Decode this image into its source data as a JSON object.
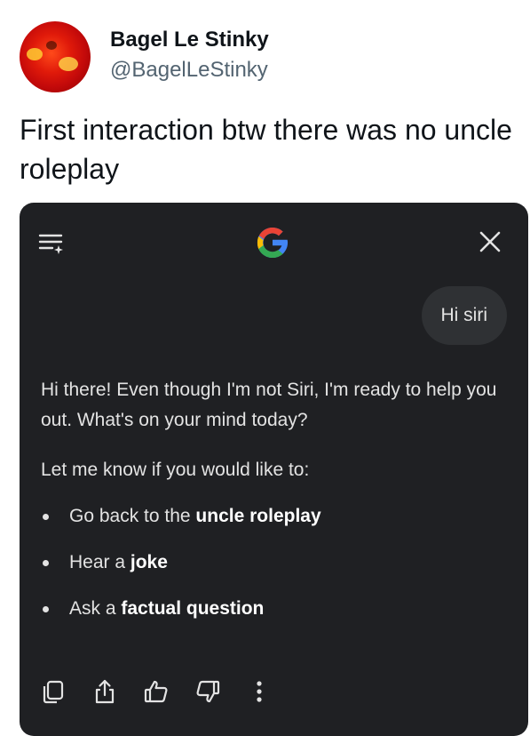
{
  "tweet": {
    "display_name": "Bagel Le Stinky",
    "handle": "@BagelLeStinky",
    "text": "First interaction btw there was no uncle roleplay"
  },
  "screenshot": {
    "header": {
      "menu_icon": "menu-sparkle-icon",
      "logo": "google-g-logo",
      "close_icon": "close-icon"
    },
    "user_message": "Hi siri",
    "reply": {
      "paragraph1": "Hi there! Even though I'm not Siri, I'm ready to help you out. What's on your mind today?",
      "paragraph2": "Let me know if you would like to:",
      "bullets": [
        {
          "prefix": "Go back to the ",
          "bold": "uncle roleplay"
        },
        {
          "prefix": "Hear a ",
          "bold": "joke"
        },
        {
          "prefix": "Ask a ",
          "bold": "factual question"
        }
      ]
    },
    "actions": [
      "copy-icon",
      "share-icon",
      "thumbs-up-icon",
      "thumbs-down-icon",
      "more-vertical-icon"
    ]
  },
  "colors": {
    "card_bg": "#1f2023",
    "bubble_bg": "#2f3134",
    "text_light": "#e3e3e3",
    "handle_gray": "#536471"
  }
}
